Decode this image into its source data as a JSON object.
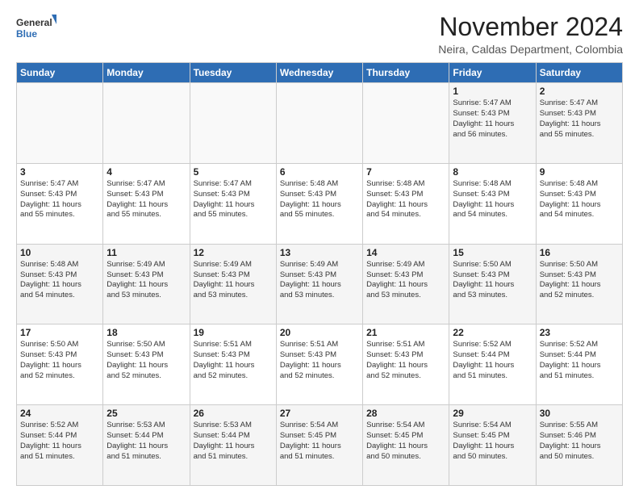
{
  "header": {
    "logo_general": "General",
    "logo_blue": "Blue",
    "month_year": "November 2024",
    "location": "Neira, Caldas Department, Colombia"
  },
  "days_of_week": [
    "Sunday",
    "Monday",
    "Tuesday",
    "Wednesday",
    "Thursday",
    "Friday",
    "Saturday"
  ],
  "weeks": [
    [
      {
        "day": "",
        "info": ""
      },
      {
        "day": "",
        "info": ""
      },
      {
        "day": "",
        "info": ""
      },
      {
        "day": "",
        "info": ""
      },
      {
        "day": "",
        "info": ""
      },
      {
        "day": "1",
        "info": "Sunrise: 5:47 AM\nSunset: 5:43 PM\nDaylight: 11 hours\nand 56 minutes."
      },
      {
        "day": "2",
        "info": "Sunrise: 5:47 AM\nSunset: 5:43 PM\nDaylight: 11 hours\nand 55 minutes."
      }
    ],
    [
      {
        "day": "3",
        "info": "Sunrise: 5:47 AM\nSunset: 5:43 PM\nDaylight: 11 hours\nand 55 minutes."
      },
      {
        "day": "4",
        "info": "Sunrise: 5:47 AM\nSunset: 5:43 PM\nDaylight: 11 hours\nand 55 minutes."
      },
      {
        "day": "5",
        "info": "Sunrise: 5:47 AM\nSunset: 5:43 PM\nDaylight: 11 hours\nand 55 minutes."
      },
      {
        "day": "6",
        "info": "Sunrise: 5:48 AM\nSunset: 5:43 PM\nDaylight: 11 hours\nand 55 minutes."
      },
      {
        "day": "7",
        "info": "Sunrise: 5:48 AM\nSunset: 5:43 PM\nDaylight: 11 hours\nand 54 minutes."
      },
      {
        "day": "8",
        "info": "Sunrise: 5:48 AM\nSunset: 5:43 PM\nDaylight: 11 hours\nand 54 minutes."
      },
      {
        "day": "9",
        "info": "Sunrise: 5:48 AM\nSunset: 5:43 PM\nDaylight: 11 hours\nand 54 minutes."
      }
    ],
    [
      {
        "day": "10",
        "info": "Sunrise: 5:48 AM\nSunset: 5:43 PM\nDaylight: 11 hours\nand 54 minutes."
      },
      {
        "day": "11",
        "info": "Sunrise: 5:49 AM\nSunset: 5:43 PM\nDaylight: 11 hours\nand 53 minutes."
      },
      {
        "day": "12",
        "info": "Sunrise: 5:49 AM\nSunset: 5:43 PM\nDaylight: 11 hours\nand 53 minutes."
      },
      {
        "day": "13",
        "info": "Sunrise: 5:49 AM\nSunset: 5:43 PM\nDaylight: 11 hours\nand 53 minutes."
      },
      {
        "day": "14",
        "info": "Sunrise: 5:49 AM\nSunset: 5:43 PM\nDaylight: 11 hours\nand 53 minutes."
      },
      {
        "day": "15",
        "info": "Sunrise: 5:50 AM\nSunset: 5:43 PM\nDaylight: 11 hours\nand 53 minutes."
      },
      {
        "day": "16",
        "info": "Sunrise: 5:50 AM\nSunset: 5:43 PM\nDaylight: 11 hours\nand 52 minutes."
      }
    ],
    [
      {
        "day": "17",
        "info": "Sunrise: 5:50 AM\nSunset: 5:43 PM\nDaylight: 11 hours\nand 52 minutes."
      },
      {
        "day": "18",
        "info": "Sunrise: 5:50 AM\nSunset: 5:43 PM\nDaylight: 11 hours\nand 52 minutes."
      },
      {
        "day": "19",
        "info": "Sunrise: 5:51 AM\nSunset: 5:43 PM\nDaylight: 11 hours\nand 52 minutes."
      },
      {
        "day": "20",
        "info": "Sunrise: 5:51 AM\nSunset: 5:43 PM\nDaylight: 11 hours\nand 52 minutes."
      },
      {
        "day": "21",
        "info": "Sunrise: 5:51 AM\nSunset: 5:43 PM\nDaylight: 11 hours\nand 52 minutes."
      },
      {
        "day": "22",
        "info": "Sunrise: 5:52 AM\nSunset: 5:44 PM\nDaylight: 11 hours\nand 51 minutes."
      },
      {
        "day": "23",
        "info": "Sunrise: 5:52 AM\nSunset: 5:44 PM\nDaylight: 11 hours\nand 51 minutes."
      }
    ],
    [
      {
        "day": "24",
        "info": "Sunrise: 5:52 AM\nSunset: 5:44 PM\nDaylight: 11 hours\nand 51 minutes."
      },
      {
        "day": "25",
        "info": "Sunrise: 5:53 AM\nSunset: 5:44 PM\nDaylight: 11 hours\nand 51 minutes."
      },
      {
        "day": "26",
        "info": "Sunrise: 5:53 AM\nSunset: 5:44 PM\nDaylight: 11 hours\nand 51 minutes."
      },
      {
        "day": "27",
        "info": "Sunrise: 5:54 AM\nSunset: 5:45 PM\nDaylight: 11 hours\nand 51 minutes."
      },
      {
        "day": "28",
        "info": "Sunrise: 5:54 AM\nSunset: 5:45 PM\nDaylight: 11 hours\nand 50 minutes."
      },
      {
        "day": "29",
        "info": "Sunrise: 5:54 AM\nSunset: 5:45 PM\nDaylight: 11 hours\nand 50 minutes."
      },
      {
        "day": "30",
        "info": "Sunrise: 5:55 AM\nSunset: 5:46 PM\nDaylight: 11 hours\nand 50 minutes."
      }
    ]
  ]
}
